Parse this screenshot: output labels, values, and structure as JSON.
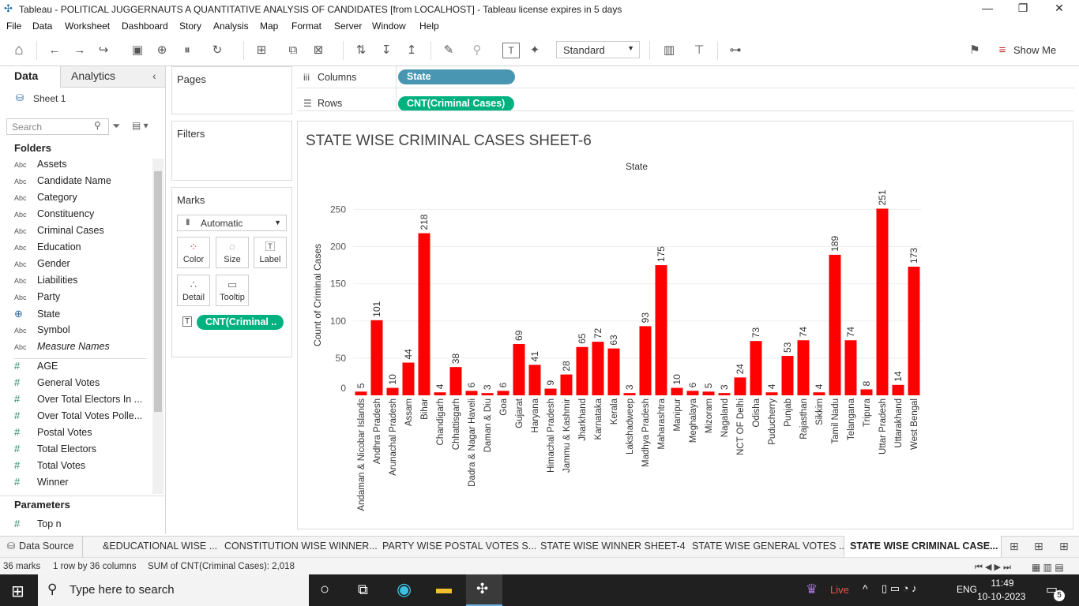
{
  "window": {
    "title": "Tableau - POLITICAL JUGGERNAUTS A QUANTITATIVE ANALYSIS OF CANDIDATES [from LOCALHOST] - Tableau license expires in 5 days"
  },
  "menu": [
    "File",
    "Data",
    "Worksheet",
    "Dashboard",
    "Story",
    "Analysis",
    "Map",
    "Format",
    "Server",
    "Window",
    "Help"
  ],
  "toolbar": {
    "fit_value": "Standard",
    "show_me": "Show Me"
  },
  "datapane": {
    "tab_data": "Data",
    "tab_analytics": "Analytics",
    "source": "Sheet 1",
    "search_placeholder": "Search",
    "folders_heading": "Folders",
    "parameters_heading": "Parameters",
    "dimensions": [
      {
        "name": "Assets",
        "type": "Abc"
      },
      {
        "name": "Candidate Name",
        "type": "Abc"
      },
      {
        "name": "Category",
        "type": "Abc"
      },
      {
        "name": "Constituency",
        "type": "Abc"
      },
      {
        "name": "Criminal Cases",
        "type": "Abc"
      },
      {
        "name": "Education",
        "type": "Abc"
      },
      {
        "name": "Gender",
        "type": "Abc"
      },
      {
        "name": "Liabilities",
        "type": "Abc"
      },
      {
        "name": "Party",
        "type": "Abc"
      },
      {
        "name": "State",
        "type": "geo"
      },
      {
        "name": "Symbol",
        "type": "Abc"
      },
      {
        "name": "Measure Names",
        "type": "Abc"
      }
    ],
    "measures": [
      "AGE",
      "General Votes",
      "Over Total Electors  In ...",
      "Over Total Votes Polle...",
      "Postal Votes",
      "Total Electors",
      "Total Votes",
      "Winner"
    ],
    "parameters": [
      "Top n"
    ]
  },
  "cards": {
    "pages": "Pages",
    "filters": "Filters",
    "marks": "Marks",
    "mark_type": "Automatic",
    "buttons": [
      "Color",
      "Size",
      "Label",
      "Detail",
      "Tooltip"
    ],
    "marks_pill": "CNT(Criminal .."
  },
  "shelves": {
    "columns_label": "Columns",
    "columns_pill": "State",
    "rows_label": "Rows",
    "rows_pill": "CNT(Criminal Cases)"
  },
  "colors": {
    "bar": "#ff0000",
    "dimension_pill": "#4996b2",
    "measure_pill": "#00b180"
  },
  "chart_data": {
    "type": "bar",
    "title": "STATE WISE CRIMINAL CASES SHEET-6",
    "header": "State",
    "ylabel": "Count of Criminal Cases",
    "ylim": [
      0,
      260
    ],
    "yticks": [
      0,
      50,
      100,
      150,
      200,
      250
    ],
    "grid": "horizontal",
    "categories": [
      "Andaman & Nicobar Islands",
      "Andhra Pradesh",
      "Arunachal Pradesh",
      "Assam",
      "Bihar",
      "Chandigarh",
      "Chhattisgarh",
      "Dadra & Nagar Haveli",
      "Daman & Diu",
      "Goa",
      "Gujarat",
      "Haryana",
      "Himachal Pradesh",
      "Jammu & Kashmir",
      "Jharkhand",
      "Karnataka",
      "Kerala",
      "Lakshadweep",
      "Madhya Pradesh",
      "Maharashtra",
      "Manipur",
      "Meghalaya",
      "Mizoram",
      "Nagaland",
      "NCT OF Delhi",
      "Odisha",
      "Puducherry",
      "Punjab",
      "Rajasthan",
      "Sikkim",
      "Tamil Nadu",
      "Telangana",
      "Tripura",
      "Uttar Pradesh",
      "Uttarakhand",
      "West Bengal"
    ],
    "values": [
      5,
      101,
      10,
      44,
      218,
      4,
      38,
      6,
      3,
      6,
      69,
      41,
      9,
      28,
      65,
      72,
      63,
      3,
      93,
      175,
      10,
      6,
      5,
      3,
      24,
      73,
      4,
      53,
      74,
      4,
      189,
      74,
      8,
      251,
      14,
      173
    ]
  },
  "sheet_tabs": {
    "data_source": "Data Source",
    "tabs": [
      "&EDUCATIONAL WISE ...",
      "CONSTITUTION WISE WINNER...",
      "PARTY WISE POSTAL VOTES S...",
      "STATE WISE WINNER SHEET-4",
      "STATE WISE GENERAL VOTES ...",
      "STATE WISE CRIMINAL CASE..."
    ]
  },
  "status": {
    "marks": "36 marks",
    "dims": "1 row by 36 columns",
    "sum": "SUM of CNT(Criminal Cases): 2,018"
  },
  "taskbar": {
    "search": "Type here to search",
    "live": "Live",
    "lang": "ENG",
    "time": "11:49",
    "date": "10-10-2023",
    "badge": "5"
  }
}
